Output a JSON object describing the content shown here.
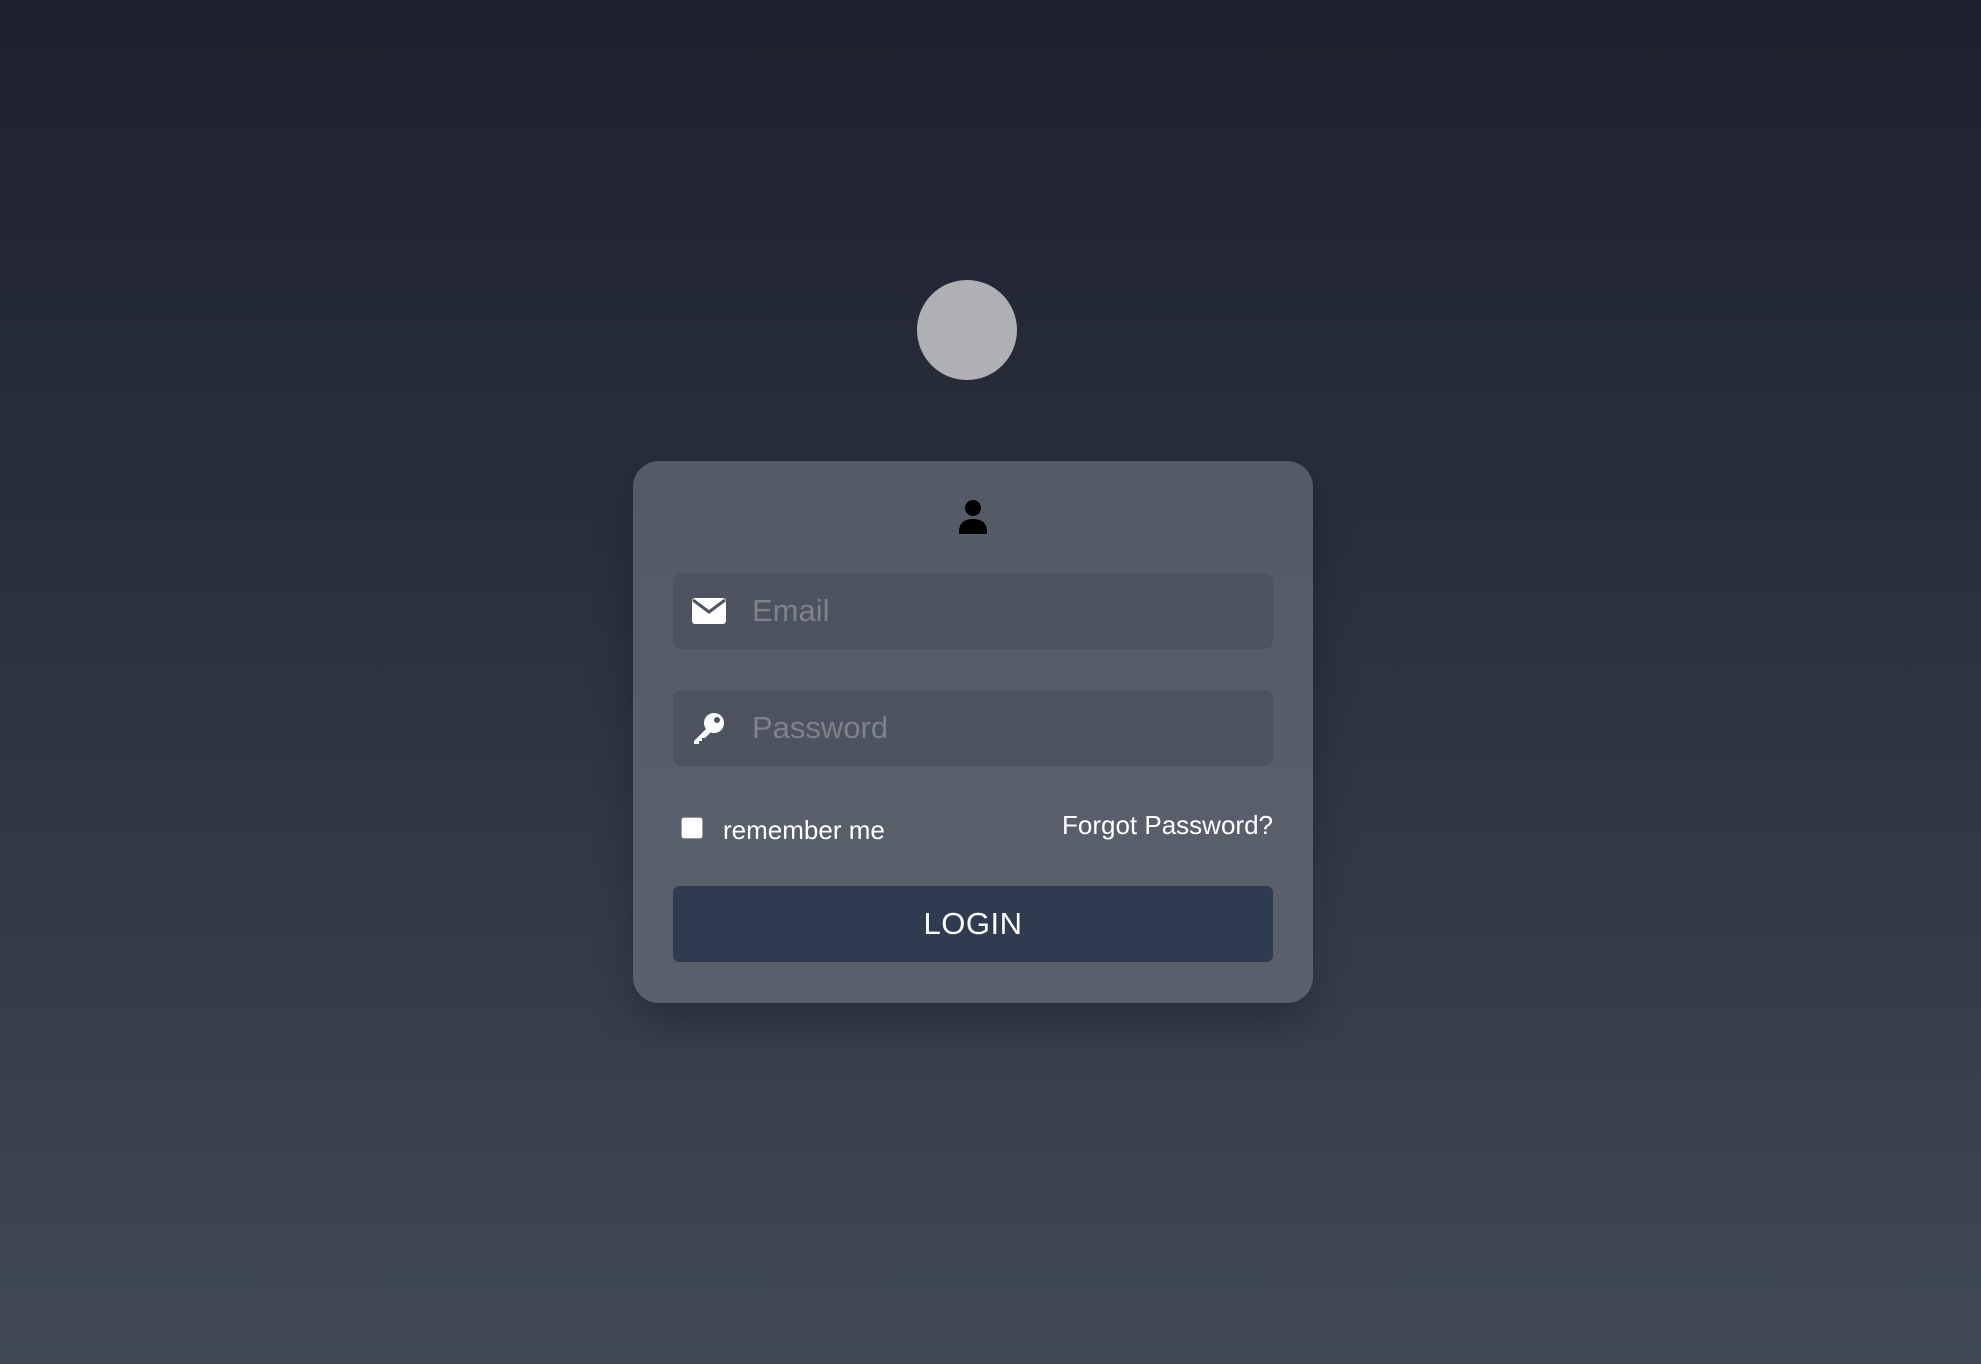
{
  "form": {
    "email_placeholder": "Email",
    "password_placeholder": "Password",
    "remember_label": "remember me",
    "forgot_label": "Forgot Password?",
    "login_label": "LOGIN"
  },
  "icons": {
    "header": "user-icon",
    "email": "envelope-icon",
    "password": "key-icon"
  },
  "colors": {
    "card": "#575d68",
    "input": "#4e545f",
    "button": "#2f3b4e",
    "avatar": "#afb0b4"
  }
}
